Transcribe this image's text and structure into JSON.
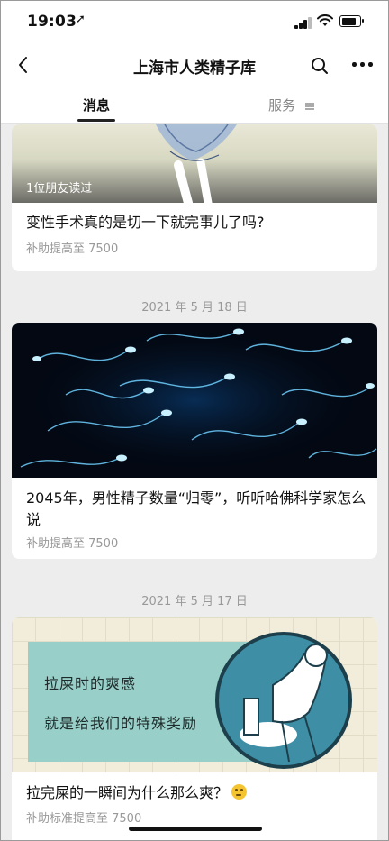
{
  "status_bar": {
    "time": "19:03",
    "location_icon": "location-arrow-icon",
    "icons": [
      "signal-icon",
      "wifi-icon",
      "battery-icon"
    ]
  },
  "navbar": {
    "title": "上海市人类精子库",
    "back_icon": "chevron-left-icon",
    "search_icon": "search-icon",
    "more_icon": "more-dots-icon"
  },
  "tabs": [
    {
      "label": "消息",
      "active": true
    },
    {
      "label": "服务",
      "active": false,
      "icon": "menu-lines-icon"
    }
  ],
  "articles": [
    {
      "readers": "1位朋友读过",
      "title": "变性手术真的是切一下就完事儿了吗?",
      "subtitle": "补助提高至 7500"
    },
    {
      "date": "2021 年 5 月 18 日",
      "title": "2045年，男性精子数量“归零”，听听哈佛科学家怎么说",
      "subtitle": "补助提高至 7500"
    },
    {
      "date": "2021 年 5 月 17 日",
      "image_text_1": "拉屎时的爽感",
      "image_text_2": "就是给我们的特殊奖励",
      "title": "拉完屎的一瞬间为什么那么爽？",
      "title_emoji": "thinking-face-icon",
      "subtitle": "补助标准提高至 7500"
    }
  ],
  "colors": {
    "background": "#ededed",
    "card": "#ffffff",
    "subtext": "#999999",
    "teal_panel": "#99cfc9"
  }
}
